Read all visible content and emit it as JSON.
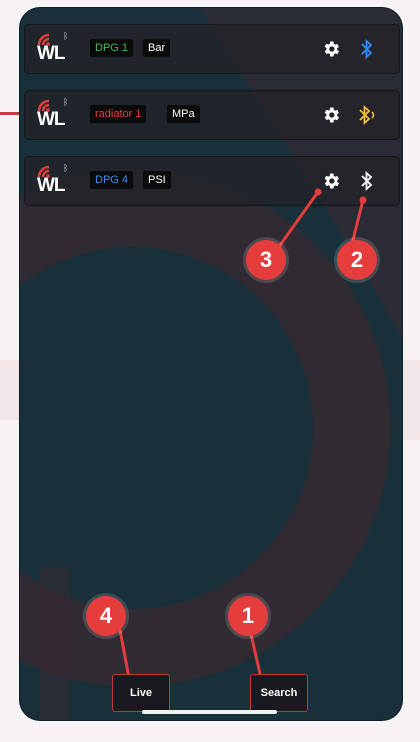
{
  "devices": [
    {
      "logo": "WL",
      "name": "DPG 1",
      "name_color": "#3fb950",
      "unit": "Bar",
      "bt_color": "#2e8cff"
    },
    {
      "logo": "WL",
      "name": "radiator 1",
      "name_color": "#e0403b",
      "unit": "MPa",
      "bt_color": "#f2c231"
    },
    {
      "logo": "WL",
      "name": "DPG 4",
      "name_color": "#3d8ee6",
      "unit": "PSI",
      "bt_color": "#ffffff"
    }
  ],
  "annotations": {
    "one": "1",
    "two": "2",
    "three": "3",
    "four": "4"
  },
  "buttons": {
    "live": "Live",
    "search": "Search"
  },
  "icons": {
    "settings": "gear-icon",
    "bluetooth": "bluetooth-icon",
    "wifi": "wifi-icon"
  },
  "colors": {
    "background": "#17303a",
    "accent": "#e53c3c"
  }
}
